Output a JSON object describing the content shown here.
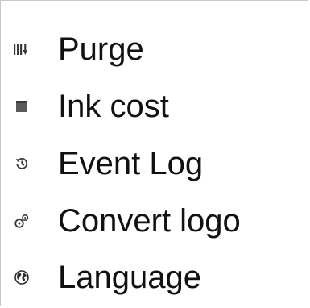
{
  "menu": {
    "items": [
      {
        "label": "Purge",
        "icon": "purge-icon"
      },
      {
        "label": "Ink cost",
        "icon": "ink-cost-icon"
      },
      {
        "label": "Event Log",
        "icon": "event-log-icon"
      },
      {
        "label": "Convert logo",
        "icon": "convert-logo-icon"
      },
      {
        "label": "Language",
        "icon": "globe-icon"
      }
    ]
  },
  "colors": {
    "text": "#111111",
    "icon": "#3a3a3a",
    "border": "#c8c8c8",
    "background": "#ffffff"
  }
}
